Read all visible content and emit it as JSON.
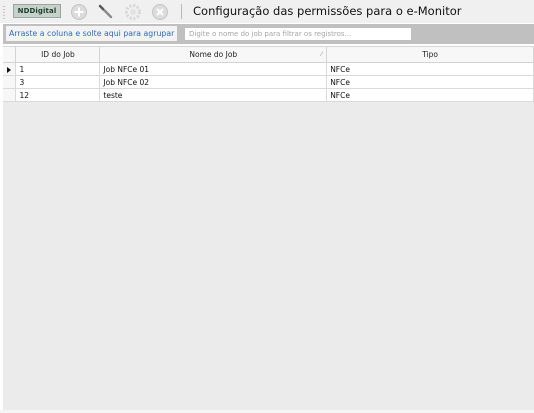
{
  "toolbar": {
    "logo_text": "NDDigital",
    "icons": [
      "add-icon",
      "edit-icon",
      "settings-icon",
      "close-icon"
    ],
    "title": "Configuração das permissões para o e-Monitor"
  },
  "groupbar": {
    "label": "Arraste a coluna e solte aqui para agrupar",
    "filter_placeholder": "Digite o nome do job para filtrar os registros..."
  },
  "grid": {
    "columns": [
      {
        "label": "ID do Job"
      },
      {
        "label": "Nome do Job",
        "sort_icon": "sort-icon"
      },
      {
        "label": "Tipo"
      }
    ],
    "rows": [
      {
        "id": "1",
        "name": "Job NFCe 01",
        "type": "NFCe",
        "current": true
      },
      {
        "id": "3",
        "name": "Job NFCe 02",
        "type": "NFCe",
        "current": false
      },
      {
        "id": "12",
        "name": "teste",
        "type": "NFCe",
        "current": false
      }
    ]
  },
  "colors": {
    "toolbar_bg": "#f0f0f0",
    "groupbar_bg": "#c0c0c0",
    "group_label_text": "#2a6bc9",
    "grid_empty_bg": "#ebebeb",
    "logo_bg": "#c7d1cb"
  }
}
